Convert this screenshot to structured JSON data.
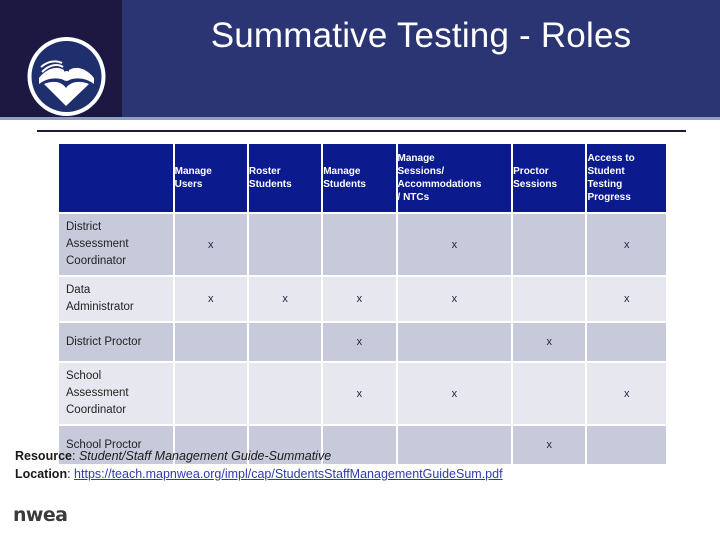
{
  "slide": {
    "title": "Summative Testing - Roles",
    "logo_icon": "nwea-book-emblem-icon",
    "wordmark": "nwea"
  },
  "table": {
    "corner_header": "",
    "columns": [
      "Manage Users",
      "Roster Students",
      "Manage Students",
      "Manage Sessions/ Accommodations / NTCs",
      "Proctor Sessions",
      "Access to Student Testing Progress"
    ],
    "column_lines": [
      [
        "Manage",
        "Users"
      ],
      [
        "Roster",
        "Students"
      ],
      [
        "Manage",
        "Students"
      ],
      [
        "Manage",
        "Sessions/",
        "Accommodations",
        "/ NTCs"
      ],
      [
        "Proctor",
        "Sessions"
      ],
      [
        "Access to",
        "Student",
        "Testing",
        "Progress"
      ]
    ],
    "mark": "x",
    "rows": [
      {
        "role": "District Assessment Coordinator",
        "role_lines": [
          "District",
          "Assessment",
          "Coordinator"
        ],
        "marks": [
          "x",
          "",
          "",
          "x",
          "",
          "x"
        ]
      },
      {
        "role": "Data Administrator",
        "role_lines": [
          "Data",
          "Administrator"
        ],
        "marks": [
          "x",
          "x",
          "x",
          "x",
          "",
          "x"
        ]
      },
      {
        "role": "District Proctor",
        "role_lines": [
          "District Proctor"
        ],
        "marks": [
          "",
          "",
          "x",
          "",
          "x",
          ""
        ]
      },
      {
        "role": "School Assessment Coordinator",
        "role_lines": [
          "School",
          "Assessment",
          "Coordinator"
        ],
        "marks": [
          "",
          "",
          "x",
          "x",
          "",
          "x"
        ]
      },
      {
        "role": "School Proctor",
        "role_lines": [
          "School Proctor"
        ],
        "marks": [
          "",
          "",
          "",
          "",
          "x",
          ""
        ]
      }
    ]
  },
  "footer": {
    "resource_label": "Resource",
    "resource_separator": ": ",
    "resource_value": "Student/Staff Management Guide-Summative",
    "location_label": "Location",
    "location_separator": ": ",
    "location_value": "https://teach.mapnwea.org/impl/cap/StudentsStaffManagementGuideSum.pdf"
  },
  "colors": {
    "banner": "#2b3573",
    "banner_dark": "#1d1842",
    "header_cell": "#0b1a8c",
    "row_shade_a": "#c6cadb",
    "row_shade_b": "#e6e7ef",
    "link": "#2d3da8"
  }
}
